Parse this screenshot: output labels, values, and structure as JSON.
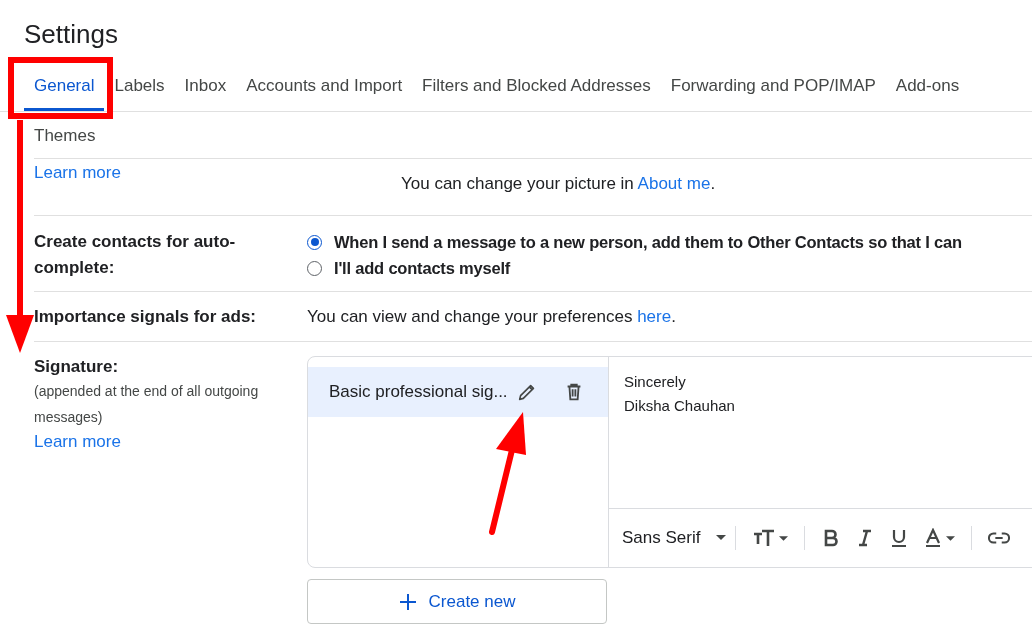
{
  "window": {
    "title": "Settings"
  },
  "tabs": [
    {
      "label": "General",
      "selected": true
    },
    {
      "label": "Labels",
      "selected": false
    },
    {
      "label": "Inbox",
      "selected": false
    },
    {
      "label": "Accounts and Import",
      "selected": false
    },
    {
      "label": "Filters and Blocked Addresses",
      "selected": false
    },
    {
      "label": "Forwarding and POP/IMAP",
      "selected": false
    },
    {
      "label": "Add-ons",
      "selected": false
    },
    {
      "label": "Themes",
      "selected": false
    }
  ],
  "profile_row": {
    "link": "Learn more",
    "text": "You can change your picture in",
    "text_link": "About me",
    "text_end": "."
  },
  "contacts_row": {
    "label": "Create contacts for auto-complete:",
    "options": [
      {
        "label": "When I send a message to a new person, add them to Other Contacts so that I can",
        "selected": true
      },
      {
        "label": "I'll add contacts myself",
        "selected": false
      }
    ]
  },
  "ads_row": {
    "label": "Importance signals for ads:",
    "text": "You can view and change your preferences",
    "text_link": "here",
    "text_end": "."
  },
  "signature_row": {
    "label": "Signature:",
    "note": "(appended at the end of all outgoing messages)",
    "link": "Learn more",
    "signatures": [
      {
        "name": "Basic professional sig...",
        "selected": true
      }
    ],
    "editor_lines": [
      "Sincerely",
      "Diksha Chauhan"
    ],
    "font": "Sans Serif",
    "create_button": "Create new"
  }
}
